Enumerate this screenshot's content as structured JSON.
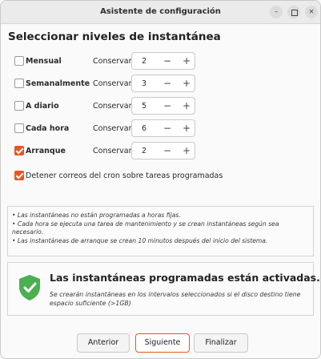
{
  "window": {
    "title": "Asistente de configuración",
    "min_symbol": "–",
    "close_symbol": "×"
  },
  "heading": "Seleccionar niveles de instantánea",
  "keep_label": "Conservar",
  "spin_symbols": {
    "minus": "−",
    "plus": "+"
  },
  "levels": [
    {
      "label": "Mensual",
      "checked": false,
      "value": "2"
    },
    {
      "label": "Semanalmente",
      "checked": false,
      "value": "3"
    },
    {
      "label": "A diario",
      "checked": false,
      "value": "5"
    },
    {
      "label": "Cada hora",
      "checked": false,
      "value": "6"
    },
    {
      "label": "Arranque",
      "checked": true,
      "value": "2"
    }
  ],
  "stop_cron_email": {
    "label": "Detener correos del cron sobre tareas programadas",
    "checked": true
  },
  "notes": [
    "• Las instantáneas no están programadas a horas fijas.",
    "• Cada hora se ejecuta una tarea de mantenimiento y se crean instantáneas según sea necesario.",
    "• Las instantáneas de arranque se crean 10 minutos después del inicio del sistema."
  ],
  "status": {
    "title": "Las instantáneas programadas están activadas.",
    "description": "Se crearán instantáneas en los intervalos seleccionados si el disco destino tiene espacio suficiente (>1GB)",
    "icon": "shield-check-icon",
    "color": "#4caf50"
  },
  "buttons": {
    "prev": "Anterior",
    "next": "Siguiente",
    "finish": "Finalizar"
  },
  "colors": {
    "accent": "#e95420",
    "success": "#4caf50"
  }
}
